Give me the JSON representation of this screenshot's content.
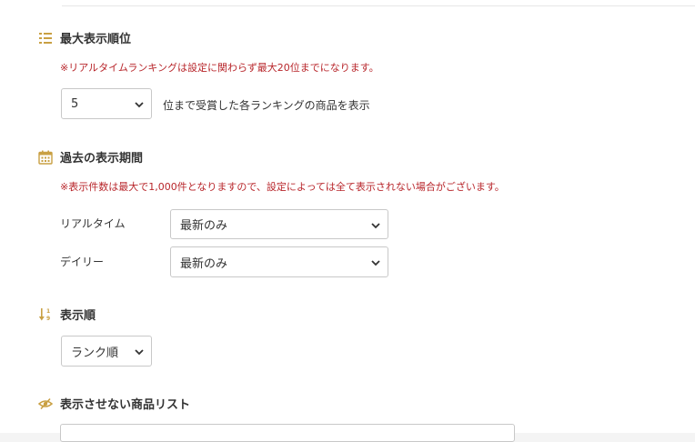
{
  "section_max_rank": {
    "title": "最大表示順位",
    "note": "※リアルタイムランキングは設定に関わらず最大20位までになります。",
    "select_value": "5",
    "suffix_text": "位まで受賞した各ランキングの商品を表示",
    "icon": "list-icon"
  },
  "section_period": {
    "title": "過去の表示期間",
    "note": "※表示件数は最大で1,000件となりますので、設定によっては全て表示されない場合がございます。",
    "icon": "calendar-icon",
    "rows": [
      {
        "label": "リアルタイム",
        "value": "最新のみ"
      },
      {
        "label": "デイリー",
        "value": "最新のみ"
      }
    ]
  },
  "section_order": {
    "title": "表示順",
    "select_value": "ランク順",
    "icon": "sort-icon"
  },
  "section_hidden": {
    "title": "表示させない商品リスト",
    "icon": "eye-slash-icon"
  },
  "colors": {
    "accent": "#c9a043",
    "note": "#b8262b"
  }
}
